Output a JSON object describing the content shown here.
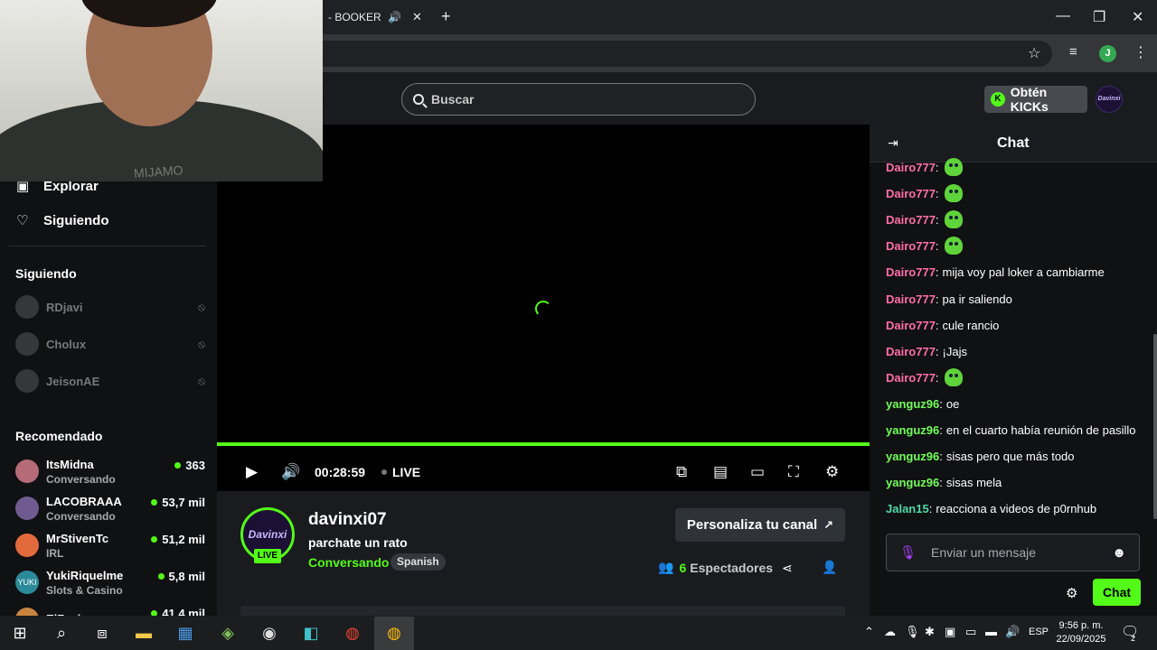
{
  "browser": {
    "tab_title": "- BOOKER T (V",
    "new_tab_label": "+",
    "profile_initial": "J"
  },
  "header": {
    "search_placeholder": "Buscar",
    "kicks_label": "Obtén KICKs",
    "avatar_text": "Davinxi"
  },
  "sidebar": {
    "nav": [
      {
        "label": "Explorar",
        "icon": "explore-icon"
      },
      {
        "label": "Siguiendo",
        "icon": "heart-icon"
      }
    ],
    "following_title": "Siguiendo",
    "following": [
      {
        "name": "RDjavi"
      },
      {
        "name": "Cholux"
      },
      {
        "name": "JeisonAE"
      }
    ],
    "recommended_title": "Recomendado",
    "recommended": [
      {
        "name": "ItsMidna",
        "category": "Conversando",
        "viewers": "363",
        "color": "#b56b78"
      },
      {
        "name": "LACOBRAAA",
        "category": "Conversando",
        "viewers": "53,7 mil",
        "color": "#6f5b8f"
      },
      {
        "name": "MrStivenTc",
        "category": "IRL",
        "viewers": "51,2 mil",
        "color": "#e26a3c"
      },
      {
        "name": "YukiRiquelme",
        "category": "Slots & Casino",
        "viewers": "5,8 mil",
        "color": "#2a8a9a",
        "avatar_text": "YUKI"
      },
      {
        "name": "ElZeein",
        "category": "",
        "viewers": "41,4 mil",
        "color": "#c8843e"
      }
    ]
  },
  "webcam": {
    "shirt_text": "MIJAMO"
  },
  "player": {
    "time": "00:28:59",
    "live_label": "LIVE",
    "progress": 1.0
  },
  "channel": {
    "avatar_text": "Davinxi",
    "live_badge": "LIVE",
    "name": "davinxi07",
    "title": "parchate un rato",
    "category": "Conversando",
    "language": "Spanish",
    "customize_label": "Personaliza tu canal",
    "viewer_count": "6",
    "viewer_label": "Espectadores"
  },
  "chat": {
    "title": "Chat",
    "messages": [
      {
        "user": "Dairo777",
        "text": "",
        "emote": true,
        "color": "#ff6ea9"
      },
      {
        "user": "Dairo777",
        "text": "",
        "emote": true,
        "color": "#ff6ea9"
      },
      {
        "user": "Dairo777",
        "text": "",
        "emote": true,
        "color": "#ff6ea9"
      },
      {
        "user": "Dairo777",
        "text": "",
        "emote": true,
        "color": "#ff6ea9"
      },
      {
        "user": "Dairo777",
        "text": "mija voy pal loker a cambiarme",
        "emote": false,
        "color": "#ff6ea9"
      },
      {
        "user": "Dairo777",
        "text": "pa ir saliendo",
        "emote": false,
        "color": "#ff6ea9"
      },
      {
        "user": "Dairo777",
        "text": "cule rancio",
        "emote": false,
        "color": "#ff6ea9"
      },
      {
        "user": "Dairo777",
        "text": "¡Jajs",
        "emote": false,
        "color": "#ff6ea9"
      },
      {
        "user": "Dairo777",
        "text": "",
        "emote": true,
        "color": "#ff6ea9"
      },
      {
        "user": "yanguz96",
        "text": "oe",
        "emote": false,
        "color": "#72ff5a"
      },
      {
        "user": "yanguz96",
        "text": "en el cuarto había reunión de pasillo",
        "emote": false,
        "color": "#72ff5a"
      },
      {
        "user": "yanguz96",
        "text": "sisas pero que más todo",
        "emote": false,
        "color": "#72ff5a"
      },
      {
        "user": "yanguz96",
        "text": "sisas mela",
        "emote": false,
        "color": "#72ff5a"
      },
      {
        "user": "Jalan15",
        "text": "reacciona a videos de p0rnhub",
        "emote": false,
        "color": "#4ed9a6"
      }
    ],
    "input_placeholder": "Enviar un mensaje",
    "send_label": "Chat"
  },
  "taskbar": {
    "language": "ESP",
    "time": "9:56 p. m.",
    "date": "22/09/2025",
    "notifications": "2"
  },
  "colors": {
    "accent": "#53fc18",
    "bg": "#0b0e0f",
    "panel": "#191b1f"
  }
}
